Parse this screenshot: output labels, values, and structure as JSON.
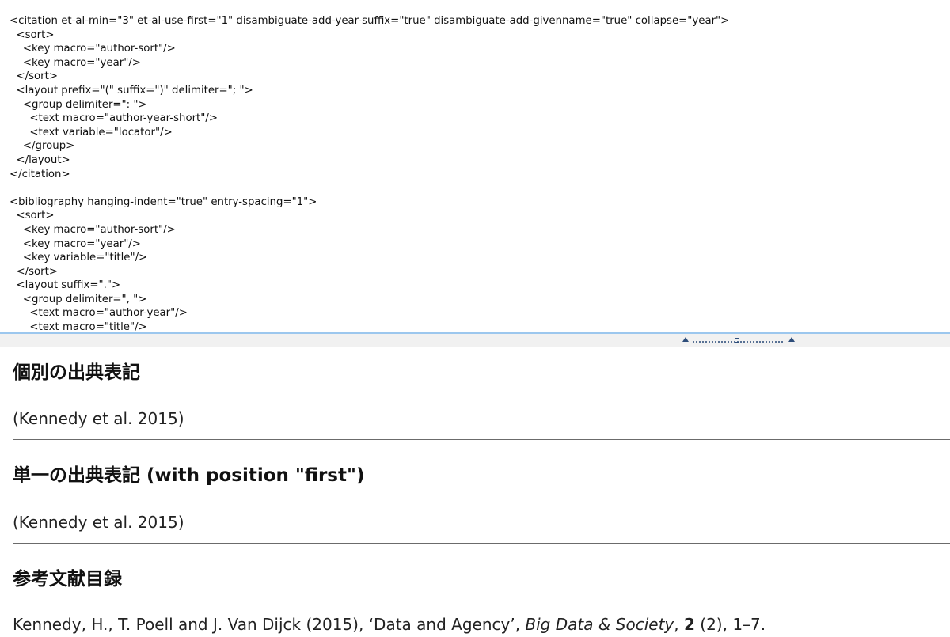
{
  "editor": {
    "code_lines": [
      "<citation et-al-min=\"3\" et-al-use-first=\"1\" disambiguate-add-year-suffix=\"true\" disambiguate-add-givenname=\"true\" collapse=\"year\">",
      "  <sort>",
      "    <key macro=\"author-sort\"/>",
      "    <key macro=\"year\"/>",
      "  </sort>",
      "  <layout prefix=\"(\" suffix=\")\" delimiter=\"; \">",
      "    <group delimiter=\": \">",
      "      <text macro=\"author-year-short\"/>",
      "      <text variable=\"locator\"/>",
      "    </group>",
      "  </layout>",
      "</citation>",
      "",
      "<bibliography hanging-indent=\"true\" entry-spacing=\"1\">",
      "  <sort>",
      "    <key macro=\"author-sort\"/>",
      "    <key macro=\"year\"/>",
      "    <key variable=\"title\"/>",
      "  </sort>",
      "  <layout suffix=\".\">",
      "    <group delimiter=\", \">",
      "      <text macro=\"author-year\"/>",
      "      <text macro=\"title\"/>"
    ]
  },
  "splitter": {
    "icon": "resize-handle-icon",
    "accent_color": "#9cc7ee"
  },
  "preview": {
    "sections": [
      {
        "heading": "個別の出典表記",
        "body": "(Kennedy et al. 2015)"
      },
      {
        "heading": "単一の出典表記 (with position \"first\")",
        "body": "(Kennedy et al. 2015)"
      },
      {
        "heading": "参考文献目録",
        "bibliography": {
          "authors_year": "Kennedy, H., T. Poell and J. Van Dijck (2015), ",
          "title": "‘Data and Agency’",
          "sep1": ", ",
          "journal": "Big Data & Society",
          "sep2": ", ",
          "volume": "2",
          "issue_pages": " (2), 1–7."
        }
      }
    ]
  }
}
